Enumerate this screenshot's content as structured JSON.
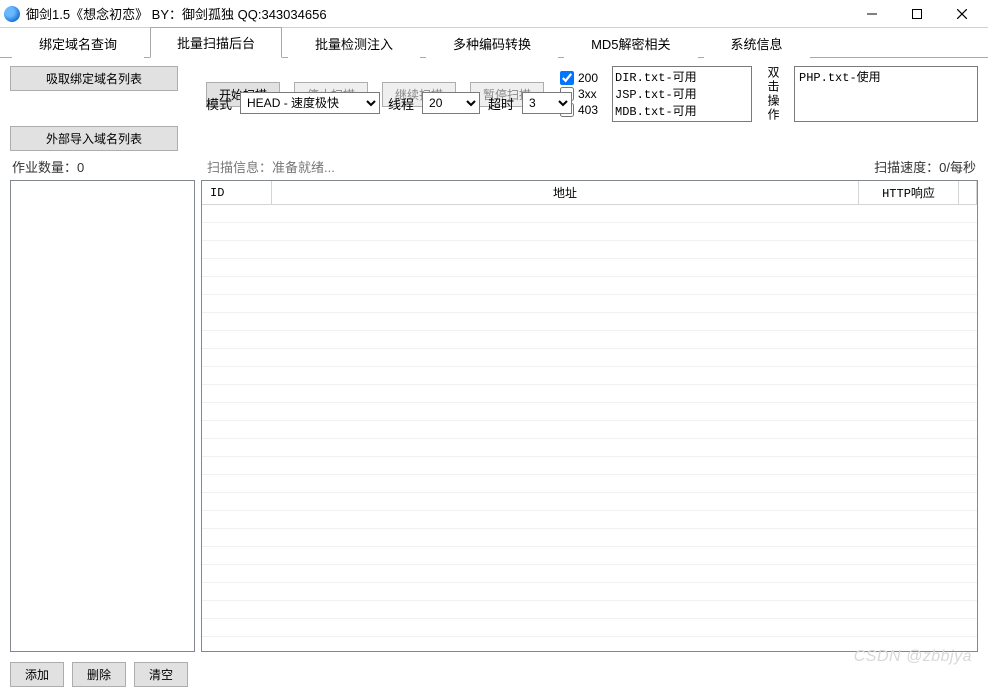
{
  "window": {
    "title": "御剑1.5《想念初恋》 BY：御剑孤独 QQ:343034656"
  },
  "tabs": {
    "t0": "绑定域名查询",
    "t1": "批量扫描后台",
    "t2": "批量检测注入",
    "t3": "多种编码转换",
    "t4": "MD5解密相关",
    "t5": "系统信息"
  },
  "buttons": {
    "absorb_domains": "吸取绑定域名列表",
    "import_domains": "外部导入域名列表",
    "start_scan": "开始扫描",
    "stop_scan": "停止扫描",
    "continue_scan": "继续扫描",
    "pause_scan": "暂停扫描",
    "add": "添加",
    "delete": "删除",
    "clear": "清空"
  },
  "labels": {
    "mode": "模式",
    "threads": "线程",
    "timeout": "超时",
    "dbl_click": "双击操作",
    "job_count_label": "作业数量：",
    "scan_info_label": "扫描信息：",
    "scan_speed_label": "扫描速度：",
    "per_sec": "/每秒"
  },
  "values": {
    "mode_selected": "HEAD - 速度极快",
    "threads_selected": "20",
    "timeout_selected": "3",
    "job_count": "0",
    "scan_info": "准备就绪...",
    "scan_speed": "0"
  },
  "filters": {
    "f200": "200",
    "f3xx": "3xx",
    "f403": "403"
  },
  "dicts": {
    "d0": "DIR.txt-可用",
    "d1": "JSP.txt-可用",
    "d2": "MDB.txt-可用",
    "current": "PHP.txt-使用"
  },
  "columns": {
    "id": "ID",
    "addr": "地址",
    "resp": "HTTP响应"
  },
  "watermark": "CSDN @zbbjya"
}
